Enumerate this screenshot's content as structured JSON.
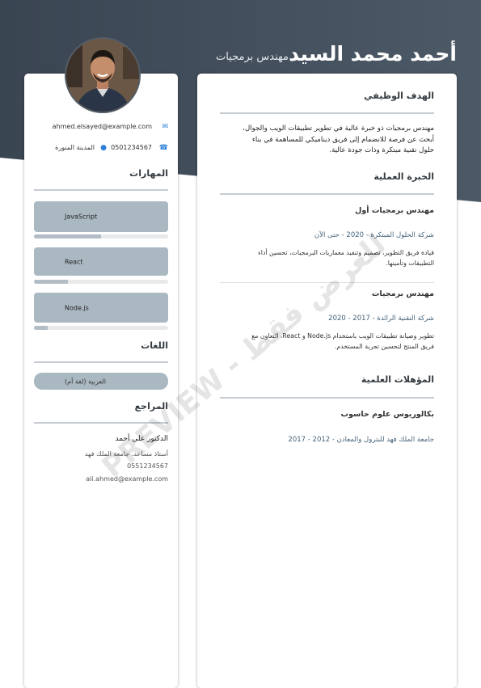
{
  "header": {
    "name": "أحمد محمد السيد",
    "job_title": "مهندس برمجيات",
    "bg_color": "#47535f"
  },
  "contact": {
    "email": "ahmed.elsayed@example.com",
    "phone": "0501234567",
    "city": "المدينة المنورة"
  },
  "skills": {
    "title": "المهارات",
    "items": [
      {
        "label": "JavaScript",
        "level": 0.5
      },
      {
        "label": "React",
        "level": 0.25
      },
      {
        "label": "Node.js",
        "level": 0.1
      }
    ]
  },
  "languages": {
    "title": "اللغات",
    "items": [
      {
        "label": "العربية (لغة أم)"
      }
    ]
  },
  "references": {
    "title": "المراجع",
    "name": "الدكتور علي أحمد",
    "position": "أستاذ مساعد، جامعة الملك فهد",
    "phone": "0551234567",
    "email": "ali.ahmed@example.com"
  },
  "objective": {
    "title": "الهدف الوظيفي",
    "lines": [
      "مهندس برمجيات ذو خبرة عالية في تطوير تطبيقات الويب والجوال،",
      "أبحث عن فرصة للانضمام إلى فريق ديناميكي للمساهمة في بناء",
      "حلول تقنية مبتكرة وذات جودة عالية."
    ]
  },
  "experience": {
    "title": "الخبرة العملية",
    "jobs": [
      {
        "title": "مهندس برمجيات أول",
        "company": "شركة الحلول المبتكرة - 2020 - حتى الآن",
        "lines": [
          "قيادة فريق التطوير، تصميم وتنفيذ معماريات البرمجيات، تحسين أداء",
          "التطبيقات وتأمينها."
        ]
      },
      {
        "title": "مهندس برمجيات",
        "company": "شركة التقنية الرائدة - 2017 - 2020",
        "lines": [
          "تطوير وصيانة تطبيقات الويب باستخدام Node.js و React، التعاون مع",
          "فريق المنتج لتحسين تجربة المستخدم."
        ]
      }
    ]
  },
  "education": {
    "title": "المؤهلات العلمية",
    "degree": "بكالوريوس علوم حاسوب",
    "school": "جامعة الملك فهد للبترول والمعادن - 2012 - 2017"
  },
  "watermark": "PREVIEW - للعرض فقط"
}
